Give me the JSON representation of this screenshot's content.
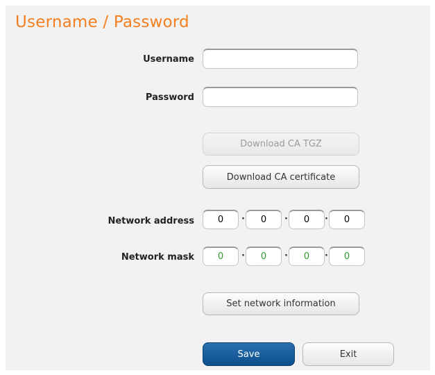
{
  "page": {
    "title": "Username / Password"
  },
  "form": {
    "username_label": "Username",
    "username_value": "",
    "password_label": "Password",
    "password_value": "",
    "download_tgz_label": "Download CA TGZ",
    "download_cert_label": "Download CA certificate",
    "network_address_label": "Network address",
    "network_address": [
      "0",
      "0",
      "0",
      "0"
    ],
    "network_mask_label": "Network mask",
    "network_mask": [
      "0",
      "0",
      "0",
      "0"
    ],
    "set_network_label": "Set network information"
  },
  "actions": {
    "save_label": "Save",
    "exit_label": "Exit"
  },
  "colors": {
    "title": "#f47f20",
    "primary_button": "#0c4f8c",
    "mask_value": "#2f9a2f"
  }
}
